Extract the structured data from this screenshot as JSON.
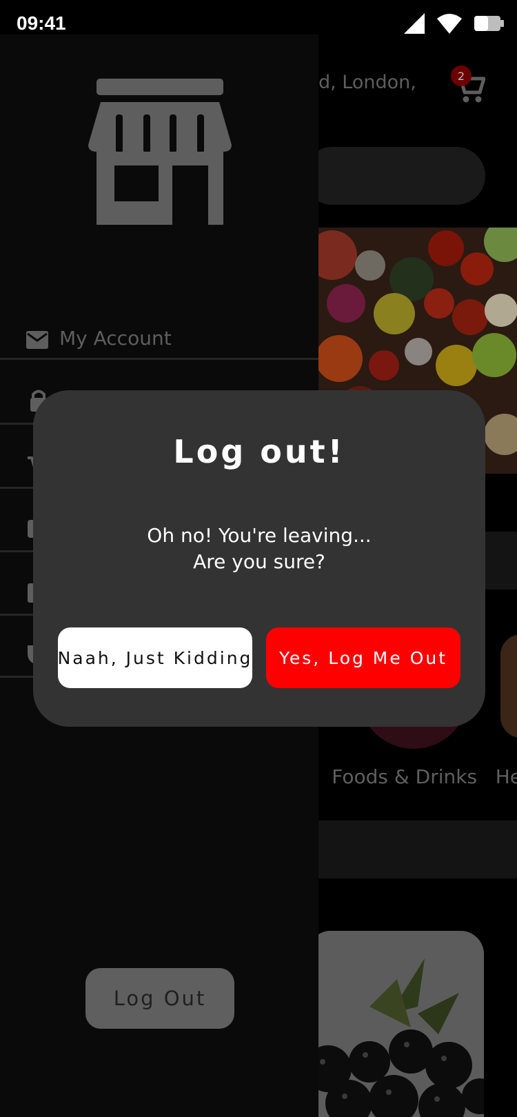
{
  "status_bar": {
    "time": "09:41"
  },
  "header": {
    "location_text": "d, London,",
    "cart_badge_count": "2"
  },
  "categories": {
    "visible_labels": "s   Foods & Drinks   He"
  },
  "drawer": {
    "menu_items": [
      {
        "label": "My Account",
        "icon": "mail-icon"
      },
      {
        "label": "",
        "icon": "lock-icon"
      },
      {
        "label": "",
        "icon": "cart-icon"
      },
      {
        "label": "",
        "icon": "checkbox-icon"
      },
      {
        "label": "",
        "icon": "calendar-icon"
      },
      {
        "label": "",
        "icon": "shield-icon"
      }
    ],
    "logout_label": "Log Out"
  },
  "dialog": {
    "title": "Log out!",
    "message_line1": "Oh no! You're leaving...",
    "message_line2": "Are you sure?",
    "cancel_label": "Naah, Just Kidding",
    "confirm_label": "Yes, Log Me Out"
  },
  "colors": {
    "dialog_bg": "#333333",
    "confirm_button": "#ff0000",
    "cancel_button": "#ffffff",
    "drawer_bg": "#0a0a0a"
  }
}
